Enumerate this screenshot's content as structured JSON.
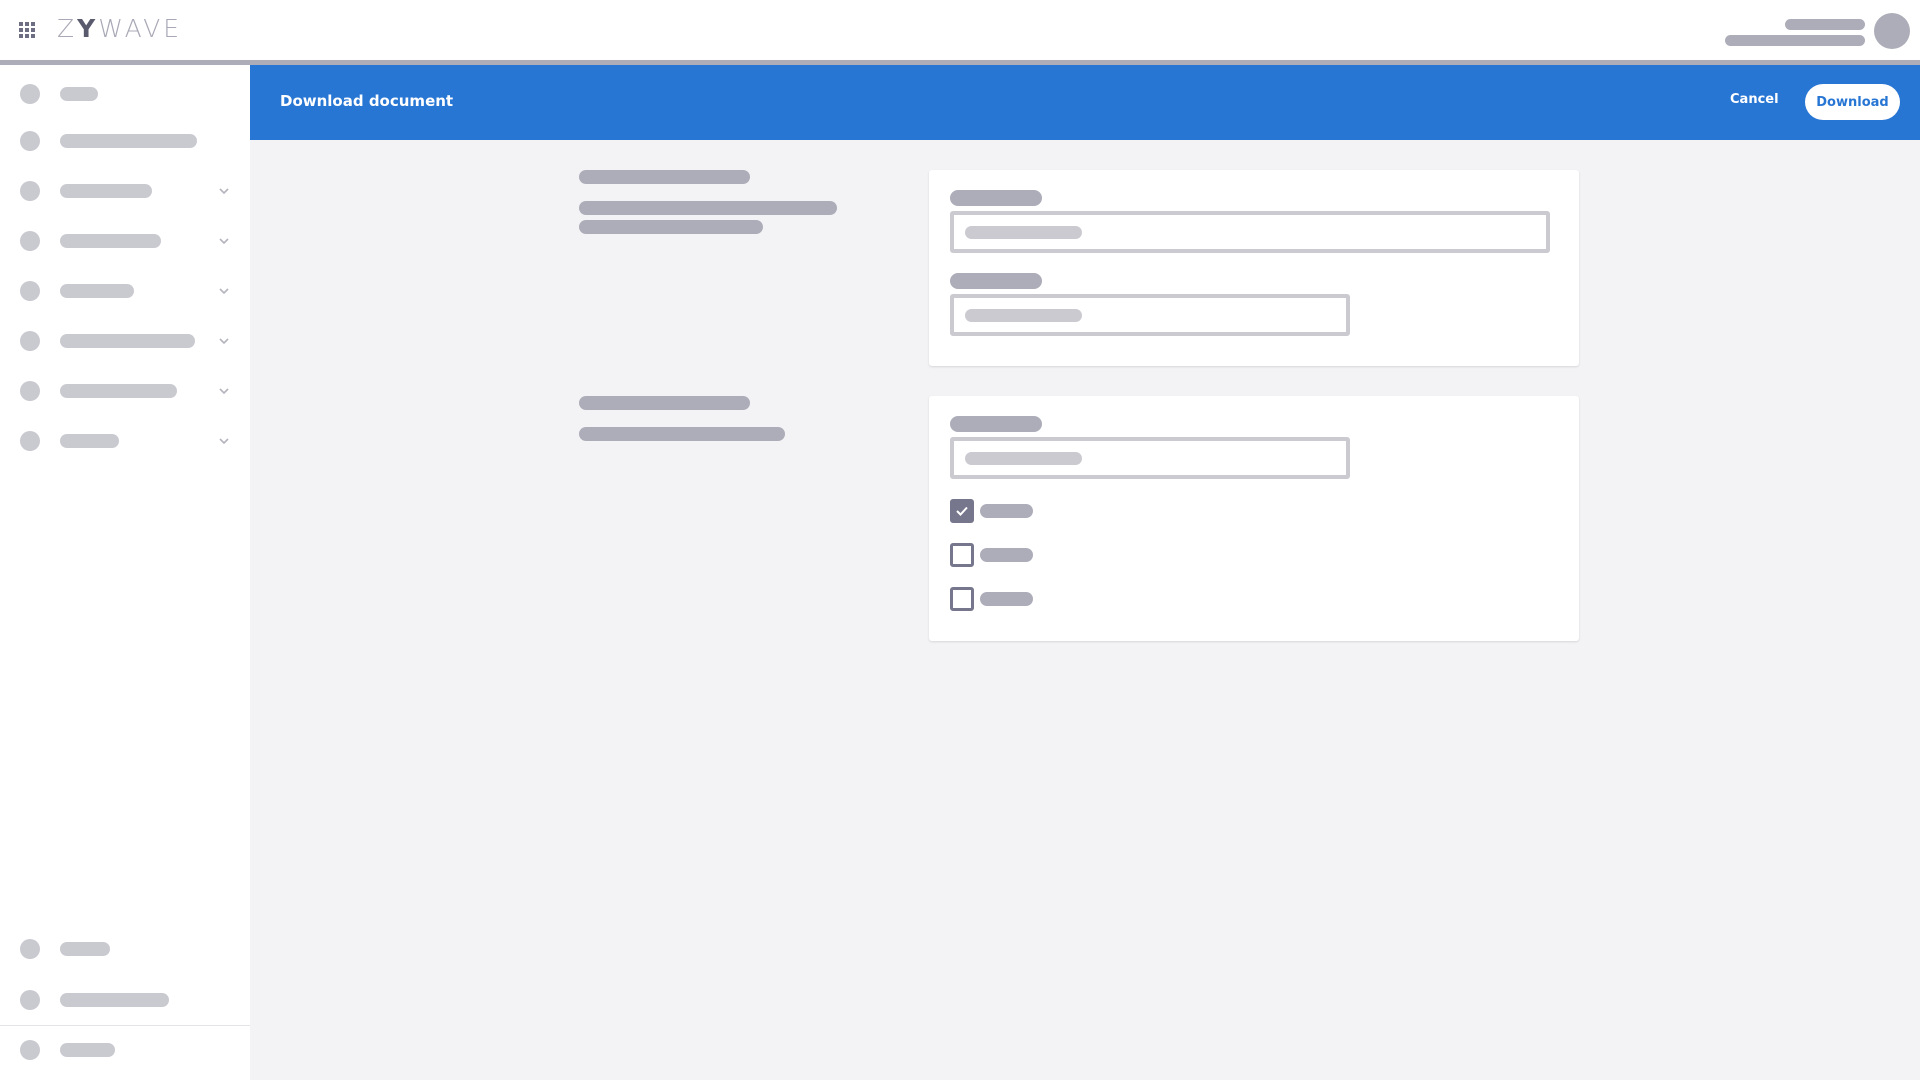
{
  "header": {
    "app_launcher_icon": "grid-icon",
    "logo_text_pre": "Z",
    "logo_text_y": "Y",
    "logo_text_post": "WAVE",
    "avatar_icon": "user-avatar"
  },
  "sidebar": {
    "items": [
      {
        "label": "",
        "icon": "circle-icon",
        "expandable": false
      },
      {
        "label": "",
        "icon": "circle-icon",
        "expandable": false
      },
      {
        "label": "",
        "icon": "circle-icon",
        "expandable": true
      },
      {
        "label": "",
        "icon": "circle-icon",
        "expandable": true
      },
      {
        "label": "",
        "icon": "circle-icon",
        "expandable": true
      },
      {
        "label": "",
        "icon": "circle-icon",
        "expandable": true
      },
      {
        "label": "",
        "icon": "circle-icon",
        "expandable": true
      },
      {
        "label": "",
        "icon": "circle-icon",
        "expandable": true
      }
    ],
    "bottom_items": [
      {
        "label": "",
        "icon": "circle-icon"
      },
      {
        "label": "",
        "icon": "circle-icon"
      },
      {
        "label": "",
        "icon": "circle-icon"
      }
    ]
  },
  "panel": {
    "title": "Download document",
    "cancel_label": "Cancel",
    "download_label": "Download",
    "accent_color": "#2876d4"
  },
  "form": {
    "sections": [
      {
        "fields": [
          {
            "type": "text-input",
            "value": "",
            "placeholder": ""
          },
          {
            "type": "text-input",
            "value": "",
            "placeholder": ""
          }
        ]
      },
      {
        "fields": [
          {
            "type": "text-input",
            "value": "",
            "placeholder": ""
          }
        ],
        "checkboxes": [
          {
            "label": "",
            "checked": true
          },
          {
            "label": "",
            "checked": false
          },
          {
            "label": "",
            "checked": false
          }
        ]
      }
    ]
  }
}
